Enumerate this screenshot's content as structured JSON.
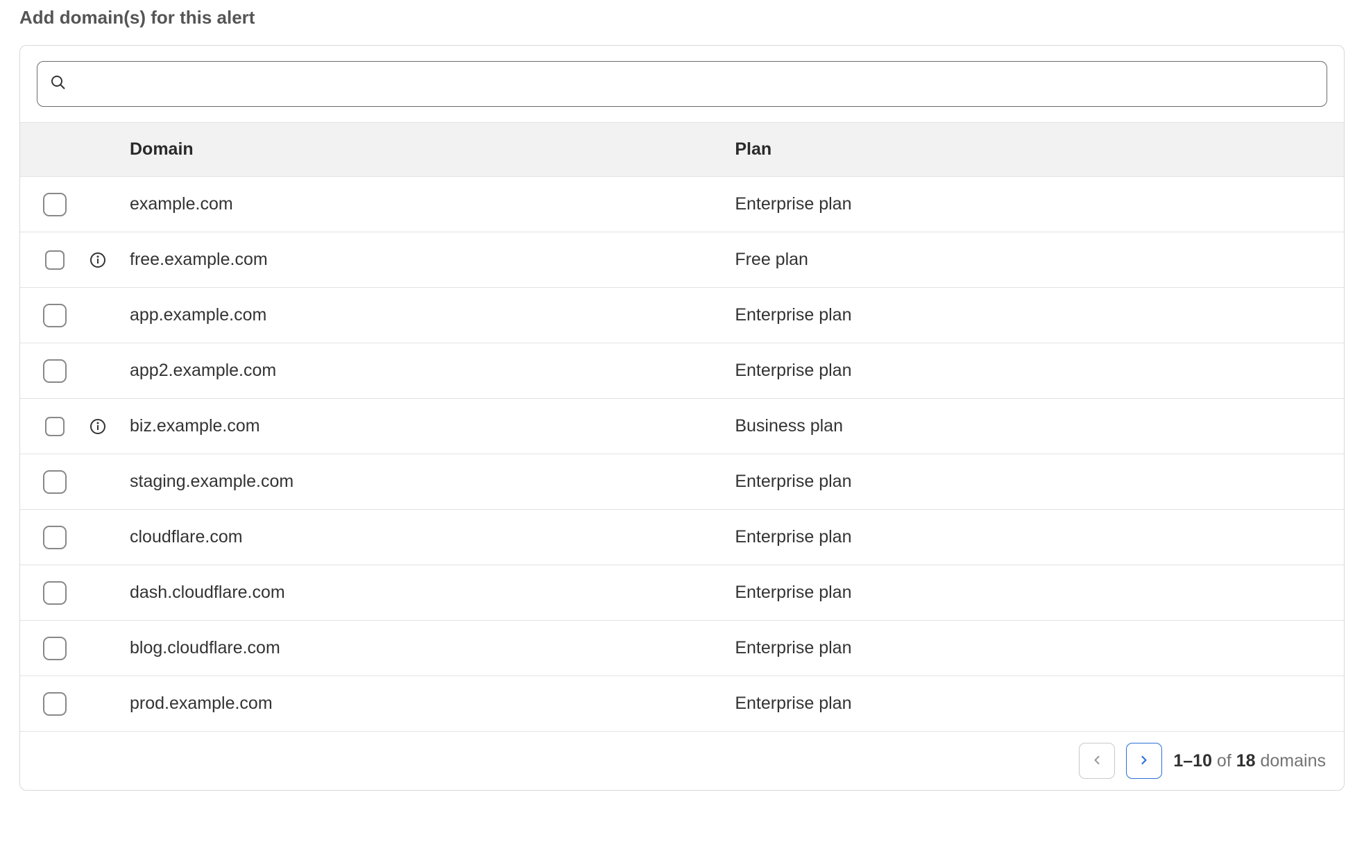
{
  "title": "Add domain(s) for this alert",
  "search": {
    "value": "",
    "placeholder": ""
  },
  "columns": {
    "domain": "Domain",
    "plan": "Plan"
  },
  "rows": [
    {
      "domain": "example.com",
      "plan": "Enterprise plan",
      "info": false,
      "smallCheck": false
    },
    {
      "domain": "free.example.com",
      "plan": "Free plan",
      "info": true,
      "smallCheck": true
    },
    {
      "domain": "app.example.com",
      "plan": "Enterprise plan",
      "info": false,
      "smallCheck": false
    },
    {
      "domain": "app2.example.com",
      "plan": "Enterprise plan",
      "info": false,
      "smallCheck": false
    },
    {
      "domain": "biz.example.com",
      "plan": "Business plan",
      "info": true,
      "smallCheck": true
    },
    {
      "domain": "staging.example.com",
      "plan": "Enterprise plan",
      "info": false,
      "smallCheck": false
    },
    {
      "domain": "cloudflare.com",
      "plan": "Enterprise plan",
      "info": false,
      "smallCheck": false
    },
    {
      "domain": "dash.cloudflare.com",
      "plan": "Enterprise plan",
      "info": false,
      "smallCheck": false
    },
    {
      "domain": "blog.cloudflare.com",
      "plan": "Enterprise plan",
      "info": false,
      "smallCheck": false
    },
    {
      "domain": "prod.example.com",
      "plan": "Enterprise plan",
      "info": false,
      "smallCheck": false
    }
  ],
  "pagination": {
    "range": "1–10",
    "of": " of ",
    "total": "18",
    "suffix": " domains"
  }
}
